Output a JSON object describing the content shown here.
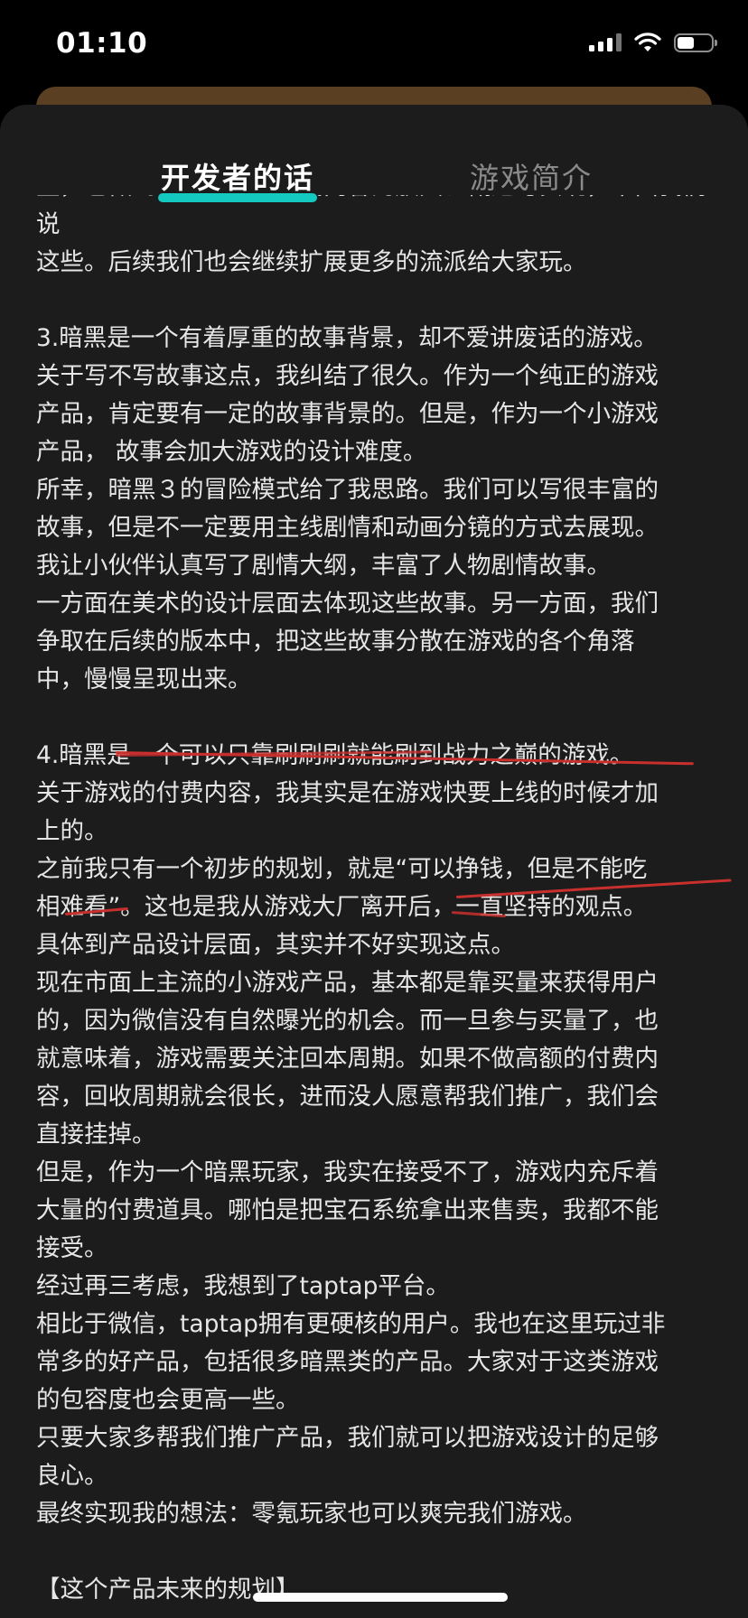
{
  "status_bar": {
    "time": "01:10"
  },
  "icons": {
    "signal": "cellular-signal-icon",
    "wifi": "wifi-icon",
    "battery": "battery-icon"
  },
  "colors": {
    "tab_underline": "#14c9c0",
    "annotation_red": "#c8302e",
    "sheet_background": "#1c1c1c",
    "card_brown": "#5a3f22"
  },
  "tabs": [
    {
      "label": "开发者的话",
      "active": true
    },
    {
      "label": "游戏简介",
      "active": false
    }
  ],
  "content": {
    "partial_top": "望，也做到了一些大家游戏内容的放大、概述与实现，下面我们说",
    "lines": [
      "这些。后续我们也会继续扩展更多的流派给大家玩。",
      "",
      "3.暗黑是一个有着厚重的故事背景，却不爱讲废话的游戏。",
      "关于写不写故事这点，我纠结了很久。作为一个纯正的游戏",
      "产品，肯定要有一定的故事背景的。但是，作为一个小游戏",
      "产品， 故事会加大游戏的设计难度。",
      "所幸，暗黑３的冒险模式给了我思路。我们可以写很丰富的",
      "故事，但是不一定要用主线剧情和动画分镜的方式去展现。",
      "我让小伙伴认真写了剧情大纲，丰富了人物剧情故事。",
      "一方面在美术的设计层面去体现这些故事。另一方面，我们",
      "争取在后续的版本中，把这些故事分散在游戏的各个角落",
      "中，慢慢呈现出来。",
      "",
      "4.暗黑是一个可以只靠刷刷刷就能刷到战力之巅的游戏。",
      "关于游戏的付费内容，我其实是在游戏快要上线的时候才加",
      "上的。",
      "之前我只有一个初步的规划，就是“可以挣钱，但是不能吃",
      "相难看”。这也是我从游戏大厂离开后，一直坚持的观点。",
      "具体到产品设计层面，其实并不好实现这点。",
      "现在市面上主流的小游戏产品，基本都是靠买量来获得用户",
      "的，因为微信没有自然曝光的机会。而一旦参与买量了，也",
      "就意味着，游戏需要关注回本周期。如果不做高额的付费内",
      "容，回收周期就会很长，进而没人愿意帮我们推广，我们会",
      "直接挂掉。",
      "但是，作为一个暗黑玩家，我实在接受不了，游戏内充斥着",
      "大量的付费道具。哪怕是把宝石系统拿出来售卖，我都不能",
      "接受。",
      "经过再三考虑，我想到了taptap平台。",
      "相比于微信，taptap拥有更硬核的用户。我也在这里玩过非",
      "常多的好产品，包括很多暗黑类的产品。大家对于这类游戏",
      "的包容度也会更高一些。",
      "只要大家多帮我们推广产品，我们就可以把游戏设计的足够",
      "良心。",
      "最终实现我的想法：零氪玩家也可以爽完我们游戏。",
      "",
      "【这个产品未来的规划】"
    ]
  }
}
